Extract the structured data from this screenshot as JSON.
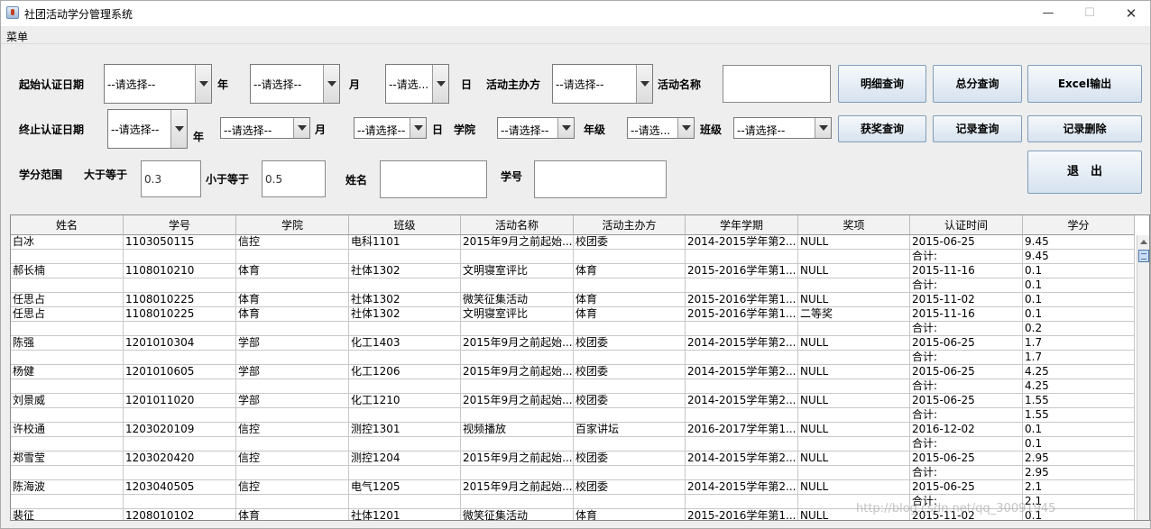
{
  "window": {
    "title": "社团活动学分管理系统"
  },
  "menubar": {
    "menu": "菜单"
  },
  "form": {
    "start_date_label": "起始认证日期",
    "end_date_label": "终止认证日期",
    "year_label": "年",
    "month_label": "月",
    "day_label": "日",
    "organizer_label": "活动主办方",
    "activity_name_label": "活动名称",
    "college_label": "学院",
    "grade_label": "年级",
    "class_label": "班级",
    "credit_range_label": "学分范围",
    "gte_label": "大于等于",
    "lte_label": "小于等于",
    "name_label": "姓名",
    "student_id_label": "学号",
    "select_placeholder": "--请选择--",
    "select_short": "--请选...",
    "gte_value": "0.3",
    "lte_value": "0.5",
    "activity_name_value": "",
    "name_value": "",
    "student_id_value": ""
  },
  "buttons": {
    "detail_query": "明细查询",
    "total_query": "总分查询",
    "excel_export": "Excel输出",
    "award_query": "获奖查询",
    "record_query": "记录查询",
    "record_delete": "记录删除",
    "exit": "退　出"
  },
  "table": {
    "columns": [
      "姓名",
      "学号",
      "学院",
      "班级",
      "活动名称",
      "活动主办方",
      "学年学期",
      "奖项",
      "认证时间",
      "学分"
    ],
    "rows": [
      [
        "白冰",
        "1103050115",
        "信控",
        "电科1101",
        "2015年9月之前起始...",
        "校团委",
        "2014-2015学年第2...",
        "NULL",
        "2015-06-25",
        "9.45"
      ],
      [
        "",
        "",
        "",
        "",
        "",
        "",
        "",
        "",
        "合计:",
        "9.45"
      ],
      [
        "郝长楠",
        "1108010210",
        "体育",
        "社体1302",
        "文明寝室评比",
        "体育",
        "2015-2016学年第1...",
        "NULL",
        "2015-11-16",
        "0.1"
      ],
      [
        "",
        "",
        "",
        "",
        "",
        "",
        "",
        "",
        "合计:",
        "0.1"
      ],
      [
        "任思占",
        "1108010225",
        "体育",
        "社体1302",
        "微笑征集活动",
        "体育",
        "2015-2016学年第1...",
        "NULL",
        "2015-11-02",
        "0.1"
      ],
      [
        "任思占",
        "1108010225",
        "体育",
        "社体1302",
        "文明寝室评比",
        "体育",
        "2015-2016学年第1...",
        "二等奖",
        "2015-11-16",
        "0.1"
      ],
      [
        "",
        "",
        "",
        "",
        "",
        "",
        "",
        "",
        "合计:",
        "0.2"
      ],
      [
        "陈强",
        "1201010304",
        "学部",
        "化工1403",
        "2015年9月之前起始...",
        "校团委",
        "2014-2015学年第2...",
        "NULL",
        "2015-06-25",
        "1.7"
      ],
      [
        "",
        "",
        "",
        "",
        "",
        "",
        "",
        "",
        "合计:",
        "1.7"
      ],
      [
        "杨健",
        "1201010605",
        "学部",
        "化工1206",
        "2015年9月之前起始...",
        "校团委",
        "2014-2015学年第2...",
        "NULL",
        "2015-06-25",
        "4.25"
      ],
      [
        "",
        "",
        "",
        "",
        "",
        "",
        "",
        "",
        "合计:",
        "4.25"
      ],
      [
        "刘景威",
        "1201011020",
        "学部",
        "化工1210",
        "2015年9月之前起始...",
        "校团委",
        "2014-2015学年第2...",
        "NULL",
        "2015-06-25",
        "1.55"
      ],
      [
        "",
        "",
        "",
        "",
        "",
        "",
        "",
        "",
        "合计:",
        "1.55"
      ],
      [
        "许校通",
        "1203020109",
        "信控",
        "测控1301",
        "视频播放",
        "百家讲坛",
        "2016-2017学年第1...",
        "NULL",
        "2016-12-02",
        "0.1"
      ],
      [
        "",
        "",
        "",
        "",
        "",
        "",
        "",
        "",
        "合计:",
        "0.1"
      ],
      [
        "郑雪莹",
        "1203020420",
        "信控",
        "测控1204",
        "2015年9月之前起始...",
        "校团委",
        "2014-2015学年第2...",
        "NULL",
        "2015-06-25",
        "2.95"
      ],
      [
        "",
        "",
        "",
        "",
        "",
        "",
        "",
        "",
        "合计:",
        "2.95"
      ],
      [
        "陈海波",
        "1203040505",
        "信控",
        "电气1205",
        "2015年9月之前起始...",
        "校团委",
        "2014-2015学年第2...",
        "NULL",
        "2015-06-25",
        "2.1"
      ],
      [
        "",
        "",
        "",
        "",
        "",
        "",
        "",
        "",
        "合计:",
        "2.1"
      ],
      [
        "裴征",
        "1208010102",
        "体育",
        "社体1201",
        "微笑征集活动",
        "体育",
        "2015-2016学年第1...",
        "NULL",
        "2015-11-02",
        "0.1"
      ]
    ]
  },
  "watermark": "http://blog.csdn.net/qq_30091945"
}
